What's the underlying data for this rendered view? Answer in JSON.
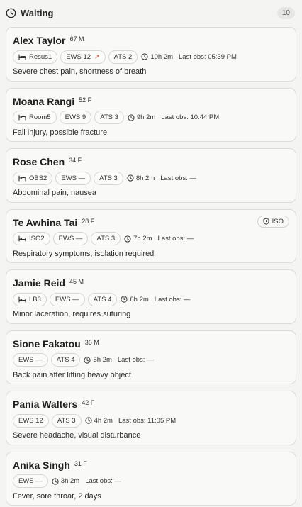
{
  "header": {
    "title": "Waiting",
    "count": "10"
  },
  "patients": [
    {
      "name": "Alex Taylor",
      "meta": "67 M",
      "room": "Resus1",
      "ews": "EWS 12",
      "ews_rising": true,
      "ats": "ATS 2",
      "wait": "10h 2m",
      "last_obs": "Last obs: 05:39 PM",
      "complaint": "Severe chest pain, shortness of breath",
      "iso": ""
    },
    {
      "name": "Moana Rangi",
      "meta": "52 F",
      "room": "Room5",
      "ews": "EWS 9",
      "ews_rising": false,
      "ats": "ATS 3",
      "wait": "9h 2m",
      "last_obs": "Last obs: 10:44 PM",
      "complaint": "Fall injury, possible fracture",
      "iso": ""
    },
    {
      "name": "Rose Chen",
      "meta": "34 F",
      "room": "OBS2",
      "ews": "EWS —",
      "ews_rising": false,
      "ats": "ATS 3",
      "wait": "8h 2m",
      "last_obs": "Last obs: —",
      "complaint": "Abdominal pain, nausea",
      "iso": ""
    },
    {
      "name": "Te Awhina Tai",
      "meta": "28 F",
      "room": "ISO2",
      "ews": "EWS —",
      "ews_rising": false,
      "ats": "ATS 3",
      "wait": "7h 2m",
      "last_obs": "Last obs: —",
      "complaint": "Respiratory symptoms, isolation required",
      "iso": "ISO"
    },
    {
      "name": "Jamie Reid",
      "meta": "45 M",
      "room": "LB3",
      "ews": "EWS —",
      "ews_rising": false,
      "ats": "ATS 4",
      "wait": "6h 2m",
      "last_obs": "Last obs: —",
      "complaint": "Minor laceration, requires suturing",
      "iso": ""
    },
    {
      "name": "Sione Fakatou",
      "meta": "36 M",
      "room": "",
      "ews": "EWS —",
      "ews_rising": false,
      "ats": "ATS 4",
      "wait": "5h 2m",
      "last_obs": "Last obs: —",
      "complaint": "Back pain after lifting heavy object",
      "iso": ""
    },
    {
      "name": "Pania Walters",
      "meta": "42 F",
      "room": "",
      "ews": "EWS 12",
      "ews_rising": false,
      "ats": "ATS 3",
      "wait": "4h 2m",
      "last_obs": "Last obs: 11:05 PM",
      "complaint": "Severe headache, visual disturbance",
      "iso": ""
    },
    {
      "name": "Anika Singh",
      "meta": "31 F",
      "room": "",
      "ews": "EWS —",
      "ews_rising": false,
      "ats": "",
      "wait": "3h 2m",
      "last_obs": "Last obs: —",
      "complaint": "Fever, sore throat, 2 days",
      "iso": ""
    }
  ]
}
